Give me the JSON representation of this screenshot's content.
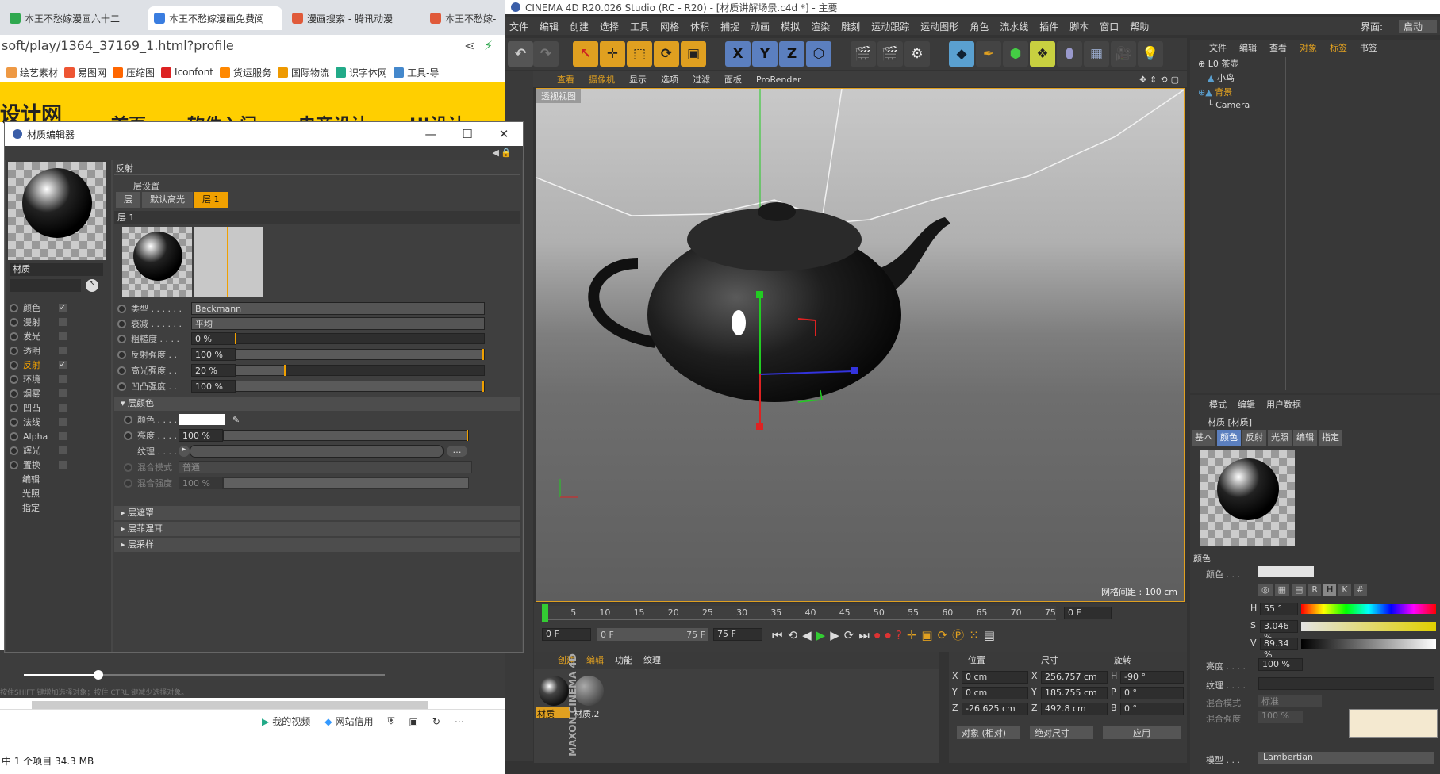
{
  "browser": {
    "tabs": [
      "本王不愁嫁漫画六十二",
      "本王不愁嫁漫画免费阅",
      "漫画搜索 - 腾讯动漫",
      "本王不愁嫁-"
    ],
    "address": "soft/play/1364_37169_1.html?profile",
    "bookmarks": [
      "绘艺素材",
      "易图网",
      "压缩图",
      "Iconfont",
      "货运服务",
      "国际物流",
      "识字体网",
      "工具-导"
    ],
    "site_logo": "设计网",
    "site_nav": [
      "首页",
      "软件入门",
      "电商设计",
      "UI设计"
    ],
    "status_links": [
      "我的视频",
      "网站信用"
    ],
    "explorer_status": "中 1 个项目  34.3 MB",
    "ghost_hint": "按住SHIFT 键增加选择对象；按住 CTRL 键减少选择对象。"
  },
  "material_editor": {
    "title": "材质编辑器",
    "material_name": "材质",
    "channels": [
      {
        "label": "颜色",
        "checked": true
      },
      {
        "label": "漫射",
        "checked": false
      },
      {
        "label": "发光",
        "checked": false
      },
      {
        "label": "透明",
        "checked": false
      },
      {
        "label": "反射",
        "checked": true,
        "active": true
      },
      {
        "label": "环境",
        "checked": false
      },
      {
        "label": "烟雾",
        "checked": false
      },
      {
        "label": "凹凸",
        "checked": false
      },
      {
        "label": "法线",
        "checked": false
      },
      {
        "label": "Alpha",
        "checked": false
      },
      {
        "label": "辉光",
        "checked": false
      },
      {
        "label": "置换",
        "checked": false
      }
    ],
    "extra_items": [
      "编辑",
      "光照",
      "指定"
    ],
    "section_title": "反射",
    "layer_settings": "层设置",
    "layer_tabs": [
      "层",
      "默认高光",
      "层 1"
    ],
    "layer_name": "层 1",
    "params": [
      {
        "label": "类型 . . . . . .",
        "value": "Beckmann"
      },
      {
        "label": "衰减 . . . . . .",
        "value": "平均"
      },
      {
        "label": "粗糙度 . . . .",
        "value": "0 %",
        "fill": 0
      },
      {
        "label": "反射强度 . .",
        "value": "100 %",
        "fill": 1
      },
      {
        "label": "高光强度 . .",
        "value": "20 %",
        "fill": 0.2
      },
      {
        "label": "凹凸强度 . .",
        "value": "100 %",
        "fill": 1
      }
    ],
    "layer_color_section": "层颜色",
    "color_params": [
      {
        "label": "颜色 . . . . .",
        "value": ""
      },
      {
        "label": "亮度 . . . . .",
        "value": "100 %",
        "fill": 1
      },
      {
        "label": "纹理 . . . . .",
        "value": ""
      },
      {
        "label": "混合模式",
        "value": "普通"
      },
      {
        "label": "混合强度",
        "value": "100 %"
      }
    ],
    "collapsed_sections": [
      "层遮罩",
      "层菲涅耳",
      "层采样"
    ]
  },
  "c4d": {
    "title": "CINEMA 4D R20.026 Studio (RC - R20) - [材质讲解场景.c4d *] - 主要",
    "menu": [
      "文件",
      "编辑",
      "创建",
      "选择",
      "工具",
      "网格",
      "体积",
      "捕捉",
      "动画",
      "模拟",
      "渲染",
      "雕刻",
      "运动跟踪",
      "运动图形",
      "角色",
      "流水线",
      "插件",
      "脚本",
      "窗口",
      "帮助"
    ],
    "interface_label": "界面:",
    "interface_value": "启动",
    "viewport_menu": [
      "查看",
      "摄像机",
      "显示",
      "选项",
      "过滤",
      "面板",
      "ProRender"
    ],
    "viewport_label": "透视视图",
    "grid_spacing": "网格间距 : 100 cm",
    "timeline_ticks": [
      "0",
      "5",
      "10",
      "15",
      "20",
      "25",
      "30",
      "35",
      "40",
      "45",
      "50",
      "55",
      "60",
      "65",
      "70",
      "75"
    ],
    "frame_current": "0 F",
    "frame_start": "0 F",
    "frame_range_start": "0 F",
    "frame_range_end": "75 F",
    "frame_end": "75 F",
    "material_manager_menu": [
      "创建",
      "编辑",
      "功能",
      "纹理"
    ],
    "materials": [
      "材质",
      "材质.2"
    ],
    "coord_headers": [
      "位置",
      "尺寸",
      "旋转"
    ],
    "coords": [
      {
        "axis": "X",
        "pos": "0 cm",
        "size": "256.757 cm",
        "rl": "H",
        "rot": "-90 °"
      },
      {
        "axis": "Y",
        "pos": "0 cm",
        "size": "185.755 cm",
        "rl": "P",
        "rot": "0 °"
      },
      {
        "axis": "Z",
        "pos": "-26.625 cm",
        "size": "492.8 cm",
        "rl": "B",
        "rot": "0 °"
      }
    ],
    "coord_mode": "对象 (相对)",
    "size_mode": "绝对尺寸",
    "apply_label": "应用",
    "object_manager_menu": [
      "文件",
      "编辑",
      "查看",
      "对象",
      "标签",
      "书签"
    ],
    "objects": [
      "茶壶",
      "小鸟",
      "背景",
      "Camera"
    ],
    "attr_menu": [
      "模式",
      "编辑",
      "用户数据"
    ],
    "attr_title": "材质 [材质]",
    "attr_tabs": [
      "基本",
      "颜色",
      "反射",
      "光照",
      "编辑",
      "指定"
    ],
    "attr_section": "颜色",
    "attr_color_label": "颜色 . . .",
    "hsv": [
      {
        "k": "H",
        "v": "55 °"
      },
      {
        "k": "S",
        "v": "3.046 %"
      },
      {
        "k": "V",
        "v": "89.34 %"
      }
    ],
    "attr_brightness_label": "亮度 . . . .",
    "attr_brightness": "100 %",
    "attr_texture_label": "纹理 . . . .",
    "attr_blend_label": "混合模式",
    "attr_blend": "标准",
    "attr_blend_strength_label": "混合强度",
    "attr_blend_strength": "100 %",
    "attr_model_label": "模型 . . .",
    "attr_model": "Lambertian",
    "maxon_label": "MAXON CINEMA 4D"
  }
}
